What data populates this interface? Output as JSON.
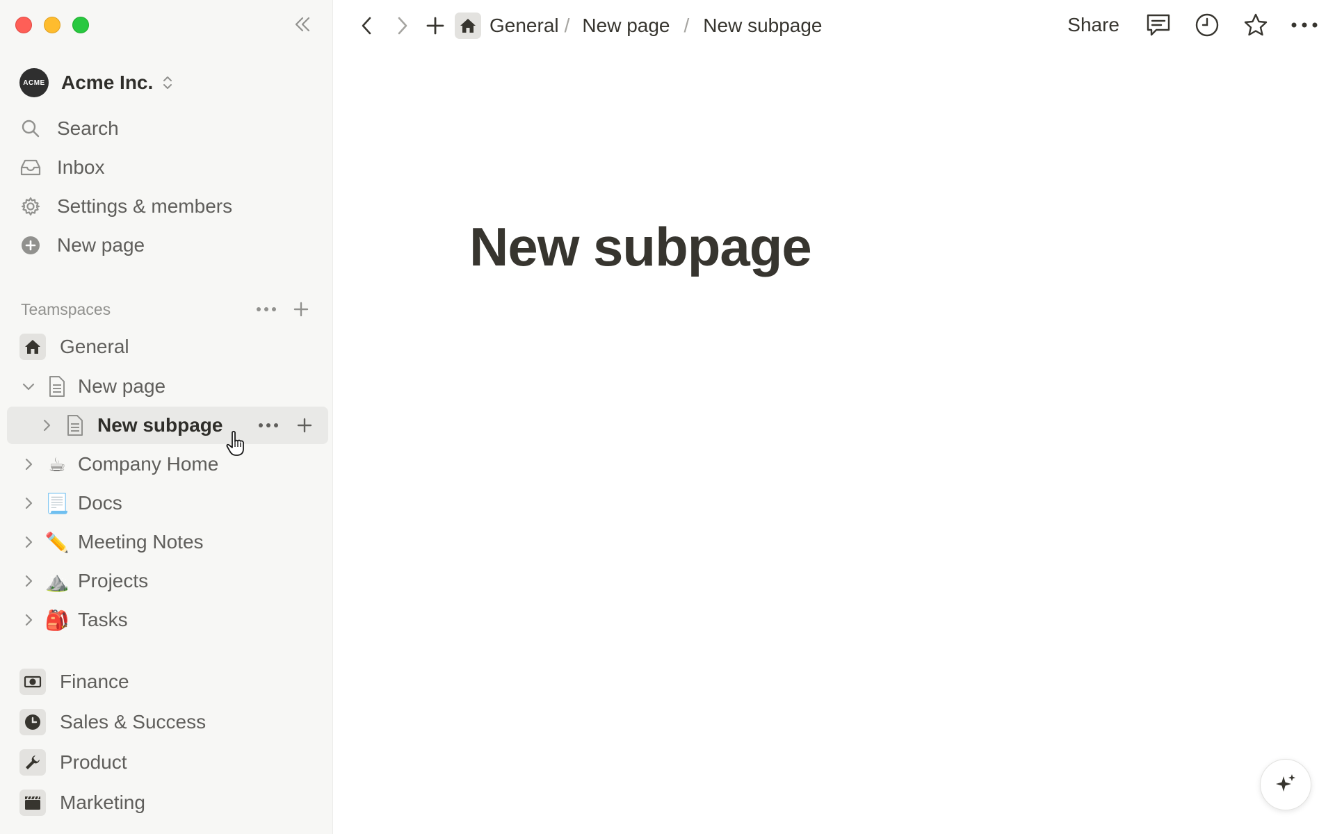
{
  "workspace": {
    "logo_text": "ACME",
    "name": "Acme Inc."
  },
  "nav": [
    {
      "label": "Search",
      "icon": "search-icon"
    },
    {
      "label": "Inbox",
      "icon": "inbox-icon"
    },
    {
      "label": "Settings & members",
      "icon": "gear-icon"
    },
    {
      "label": "New page",
      "icon": "plus-circle-icon"
    }
  ],
  "teamspaces": {
    "label": "Teamspaces",
    "tree": [
      {
        "label": "General",
        "icon": "home-icon"
      },
      {
        "label": "New page",
        "icon": "document-icon",
        "expanded": true
      },
      {
        "label": "New subpage",
        "icon": "document-icon",
        "selected": true
      },
      {
        "label": "Company Home",
        "icon": "☕"
      },
      {
        "label": "Docs",
        "icon": "📃"
      },
      {
        "label": "Meeting Notes",
        "icon": "✏️"
      },
      {
        "label": "Projects",
        "icon": "⛰️"
      },
      {
        "label": "Tasks",
        "icon": "🎒"
      }
    ],
    "teams": [
      {
        "label": "Finance",
        "icon": "money-icon"
      },
      {
        "label": "Sales & Success",
        "icon": "clock-icon"
      },
      {
        "label": "Product",
        "icon": "wrench-icon"
      },
      {
        "label": "Marketing",
        "icon": "clapper-icon"
      }
    ]
  },
  "breadcrumb": [
    {
      "label": "General",
      "separator": "/"
    },
    {
      "label": "New page",
      "separator": "/"
    },
    {
      "label": "New subpage"
    }
  ],
  "topbar": {
    "share_label": "Share"
  },
  "page": {
    "title": "New subpage"
  },
  "colors": {
    "sidebar_bg": "#f7f7f5",
    "selected_row": "#e9e9e7",
    "text": "#37352f",
    "muted": "#91918e"
  }
}
